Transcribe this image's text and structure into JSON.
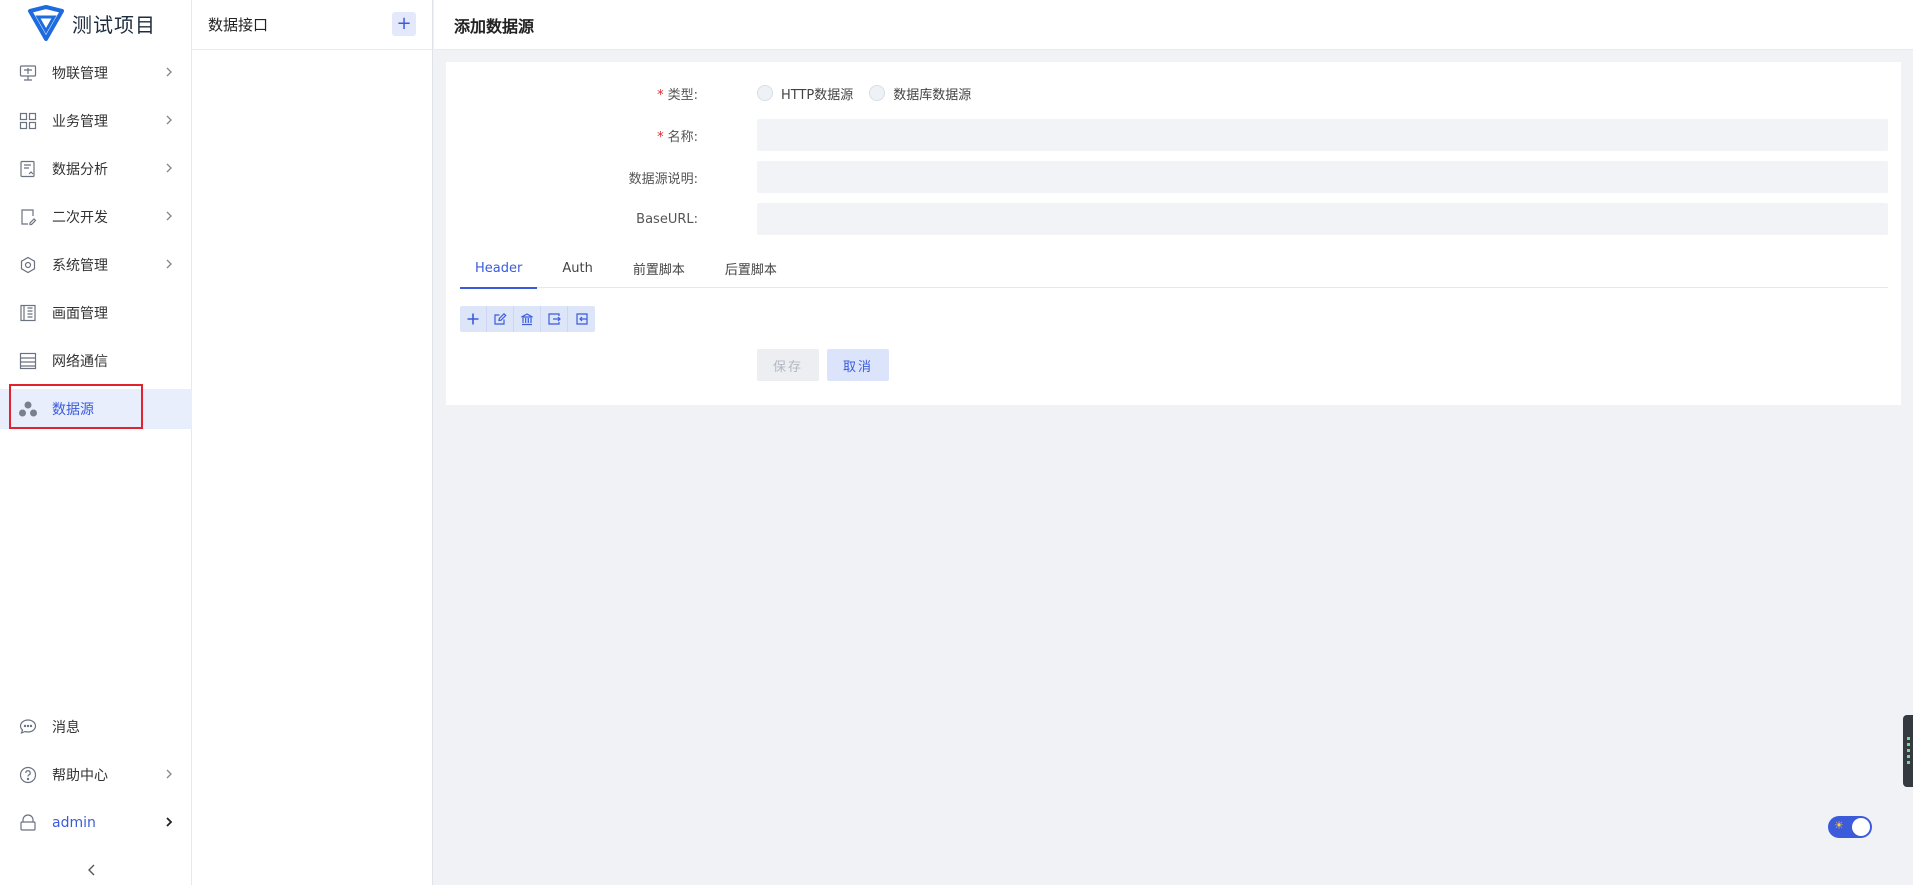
{
  "app": {
    "title": "测试项目"
  },
  "sidebar": {
    "items": [
      {
        "label": "物联管理",
        "icon": "iot-monitor-icon"
      },
      {
        "label": "业务管理",
        "icon": "grid-apps-icon"
      },
      {
        "label": "数据分析",
        "icon": "report-chart-icon"
      },
      {
        "label": "二次开发",
        "icon": "dev-edit-icon"
      },
      {
        "label": "系统管理",
        "icon": "gear-icon"
      },
      {
        "label": "画面管理",
        "icon": "canvas-grid-icon"
      },
      {
        "label": "网络通信",
        "icon": "network-list-icon"
      },
      {
        "label": "数据源",
        "icon": "datasource-nodes-icon"
      }
    ],
    "bottom": [
      {
        "label": "消息",
        "icon": "message-bubble-icon"
      },
      {
        "label": "帮助中心",
        "icon": "help-circle-icon"
      },
      {
        "label": "admin",
        "icon": "lock-user-icon"
      }
    ]
  },
  "mid": {
    "title": "数据接口",
    "add": "+"
  },
  "main": {
    "title": "添加数据源",
    "form": {
      "type_label": "类型:",
      "type_options": [
        "HTTP数据源",
        "数据库数据源"
      ],
      "name_label": "名称:",
      "desc_label": "数据源说明:",
      "baseurl_label": "BaseURL:"
    },
    "tabs": [
      "Header",
      "Auth",
      "前置脚本",
      "后置脚本"
    ],
    "toolbar": [
      "add-icon",
      "edit-icon",
      "bank-icon",
      "export-icon",
      "import-icon"
    ],
    "buttons": {
      "save": "保存",
      "cancel": "取消"
    }
  },
  "colors": {
    "accent": "#3b5bdb",
    "active_bg": "#e8eefc",
    "highlight": "#e0232e"
  }
}
